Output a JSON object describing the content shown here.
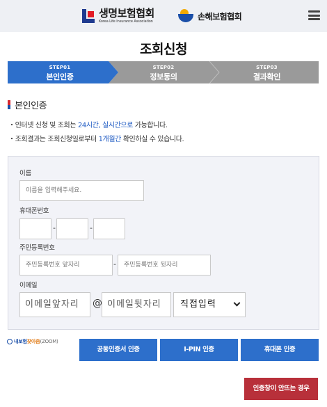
{
  "header": {
    "logo1_name": "생명보험협회",
    "logo1_sub": "Korea Life Insurance Association",
    "logo2_name": "손해보험협회",
    "menu_icon": "hamburger-menu-icon"
  },
  "page_title": "조회신청",
  "steps": [
    {
      "num": "STEP01",
      "label": "본인인증",
      "active": true
    },
    {
      "num": "STEP02",
      "label": "정보동의",
      "active": false
    },
    {
      "num": "STEP03",
      "label": "결과확인",
      "active": false
    }
  ],
  "colors": {
    "step_active": "#2d6fcb",
    "step_inactive": "#9a9a9a",
    "accent": "#1b58c2",
    "danger": "#b8303a"
  },
  "section_title": "본인인증",
  "notes": {
    "line1_a": "인터넷 신청 및 조회는 ",
    "line1_hl": "24시간, 실시간으로",
    "line1_b": " 가능합니다.",
    "line2_a": "조회결과는 조회신청일로부터 ",
    "line2_hl": "1개월간",
    "line2_b": " 확인하실 수 있습니다.",
    "bullet": "・"
  },
  "form": {
    "name_label": "이름",
    "name_placeholder": "이름을 입력해주세요.",
    "phone_label": "휴대폰번호",
    "dash": "-",
    "rrn_label": "주민등록번호",
    "rrn_front_placeholder": "주민등록번호 앞자리",
    "rrn_back_placeholder": "주민등록번호 뒷자리",
    "email_label": "이메일",
    "email_front_placeholder": "이메일앞자리",
    "email_at": "@",
    "email_back_placeholder": "이메일뒷자리",
    "email_domain_selected": "직접입력"
  },
  "zoom_link": {
    "a": "내보험",
    "b": "찾아줌",
    "c": "(ZOOM)"
  },
  "buttons": {
    "cert": "공동인증서 인증",
    "ipin": "I-PIN 인증",
    "phone": "휴대폰 인증",
    "popup": "인증창이 안뜨는 경우"
  }
}
